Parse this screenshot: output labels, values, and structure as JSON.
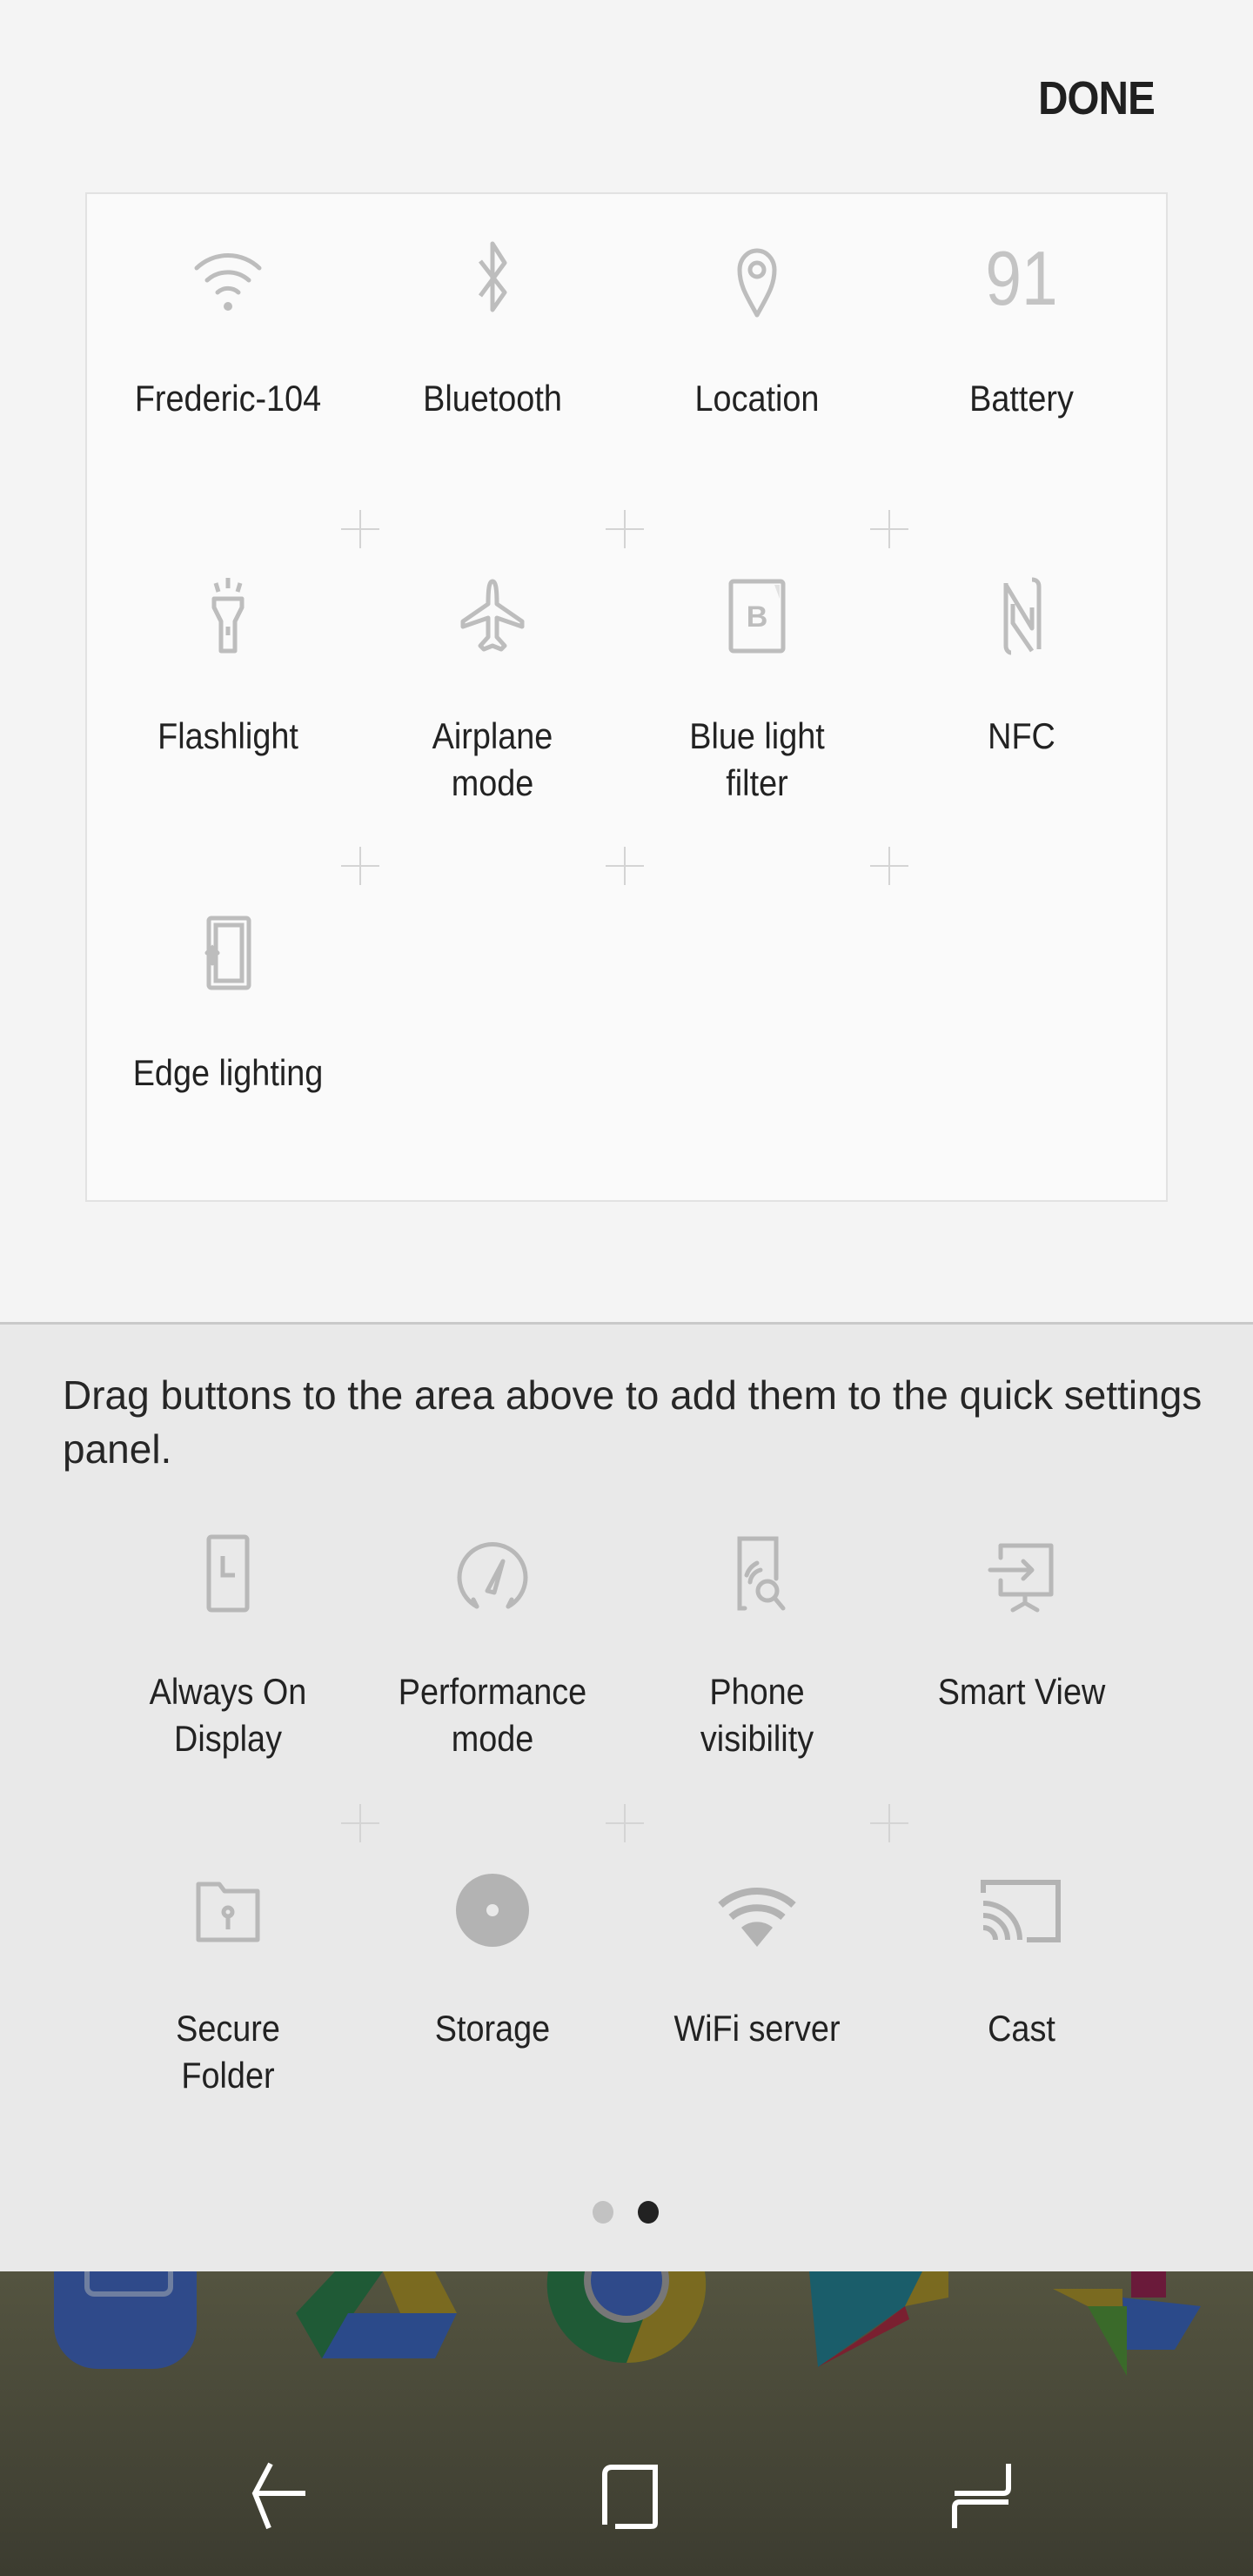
{
  "header": {
    "done_label": "DONE"
  },
  "active_panel": {
    "tiles": [
      {
        "label": "Frederic-104",
        "icon": "wifi-icon"
      },
      {
        "label": "Bluetooth",
        "icon": "bluetooth-icon"
      },
      {
        "label": "Location",
        "icon": "location-icon"
      },
      {
        "label": "Battery",
        "icon": "battery-icon",
        "value": "91"
      },
      {
        "label": "Flashlight",
        "icon": "flashlight-icon"
      },
      {
        "label": "Airplane\nmode",
        "label_line1": "Airplane",
        "label_line2": "mode",
        "icon": "airplane-icon"
      },
      {
        "label_line1": "Blue light",
        "label_line2": "filter",
        "icon": "blue-light-filter-icon",
        "glyph": "B"
      },
      {
        "label": "NFC",
        "icon": "nfc-icon"
      },
      {
        "label": "Edge lighting",
        "icon": "edge-lighting-icon"
      }
    ]
  },
  "tray": {
    "hint": "Drag buttons to the area above to add them to the quick settings panel.",
    "tiles": [
      {
        "label_line1": "Always On",
        "label_line2": "Display",
        "icon": "always-on-display-icon"
      },
      {
        "label_line1": "Performance",
        "label_line2": "mode",
        "icon": "performance-mode-icon"
      },
      {
        "label_line1": "Phone",
        "label_line2": "visibility",
        "icon": "phone-visibility-icon"
      },
      {
        "label_line1": "Smart View",
        "label_line2": "",
        "icon": "smart-view-icon"
      },
      {
        "label_line1": "Secure",
        "label_line2": "Folder",
        "icon": "secure-folder-icon"
      },
      {
        "label_line1": "Storage",
        "label_line2": "",
        "icon": "storage-icon"
      },
      {
        "label_line1": "WiFi server",
        "label_line2": "",
        "icon": "wifi-server-icon"
      },
      {
        "label_line1": "Cast",
        "label_line2": "",
        "icon": "cast-icon"
      }
    ],
    "pagination": {
      "total_pages": 2,
      "current_page": 2
    }
  },
  "colors": {
    "icon_gray": "#b3b3b3",
    "text_dark": "#222222",
    "dot_active": "#222222",
    "dot_inactive": "#c2c2c2"
  },
  "navbar": {
    "buttons": [
      "back",
      "home",
      "recents"
    ]
  }
}
